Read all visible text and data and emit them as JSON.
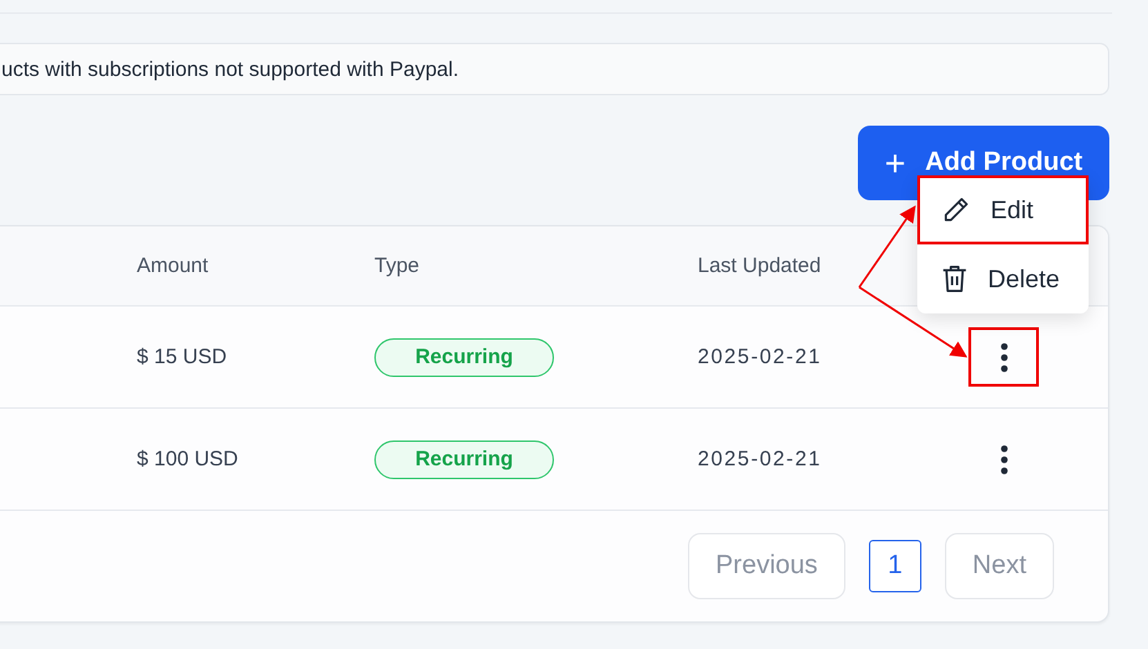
{
  "notice": {
    "text": "ucts with subscriptions not supported with Paypal."
  },
  "add_button": {
    "icon": "+",
    "label": "Add Product"
  },
  "table": {
    "columns": [
      "Amount",
      "Type",
      "Last Updated"
    ],
    "rows": [
      {
        "amount": "$ 15 USD",
        "type": "Recurring",
        "last_updated": "2025-02-21",
        "highlighted": true
      },
      {
        "amount": "$ 100 USD",
        "type": "Recurring",
        "last_updated": "2025-02-21",
        "highlighted": false
      }
    ]
  },
  "pagination": {
    "previous": "Previous",
    "pages": [
      {
        "label": "1",
        "selected": true
      }
    ],
    "next": "Next"
  },
  "action_menu": {
    "items": [
      {
        "kind": "edit",
        "label": "Edit",
        "highlighted": true
      },
      {
        "kind": "delete",
        "label": "Delete",
        "highlighted": false
      }
    ]
  }
}
